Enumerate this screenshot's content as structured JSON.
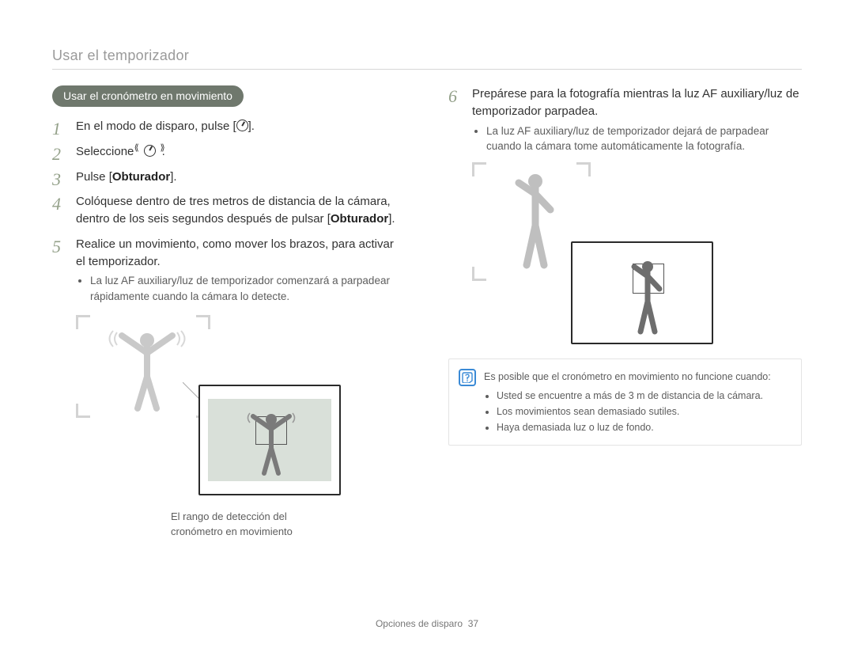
{
  "header": {
    "title": "Usar el temporizador"
  },
  "pill": {
    "label": "Usar el cronómetro en movimiento"
  },
  "left": {
    "steps": [
      {
        "pre": "En el modo de disparo, pulse [",
        "post": "]."
      },
      {
        "pre": "Seleccione ",
        "post": "."
      },
      {
        "pre": "Pulse [",
        "bold": "Obturador",
        "post": "]."
      },
      {
        "pre": "Colóquese dentro de tres metros de distancia de la cámara, dentro de los seis segundos después de pulsar [",
        "bold": "Obturador",
        "post": "]."
      },
      {
        "text": "Realice un movimiento, como mover los brazos, para activar el temporizador.",
        "bullets": [
          "La luz AF auxiliary/luz de temporizador comenzará a parpadear rápidamente cuando la cámara lo detecte."
        ]
      }
    ],
    "caption": "El rango de detección del cronómetro en movimiento"
  },
  "right": {
    "steps": [
      {
        "text": "Prepárese para la fotografía mientras la luz AF auxiliary/luz de temporizador parpadea.",
        "bullets": [
          "La luz AF auxiliary/luz de temporizador dejará de parpadear cuando la cámara tome automáticamente la fotografía."
        ]
      }
    ],
    "note": {
      "intro": "Es posible que el cronómetro en movimiento no funcione cuando:",
      "bullets": [
        "Usted se encuentre a más de 3 m de distancia de la cámara.",
        "Los movimientos sean demasiado sutiles.",
        "Haya demasiada luz o luz de fondo."
      ]
    }
  },
  "footer": {
    "section": "Opciones de disparo",
    "page": "37"
  },
  "icons": {
    "timer": "timer-icon",
    "motion_timer": "motion-timer-icon"
  }
}
